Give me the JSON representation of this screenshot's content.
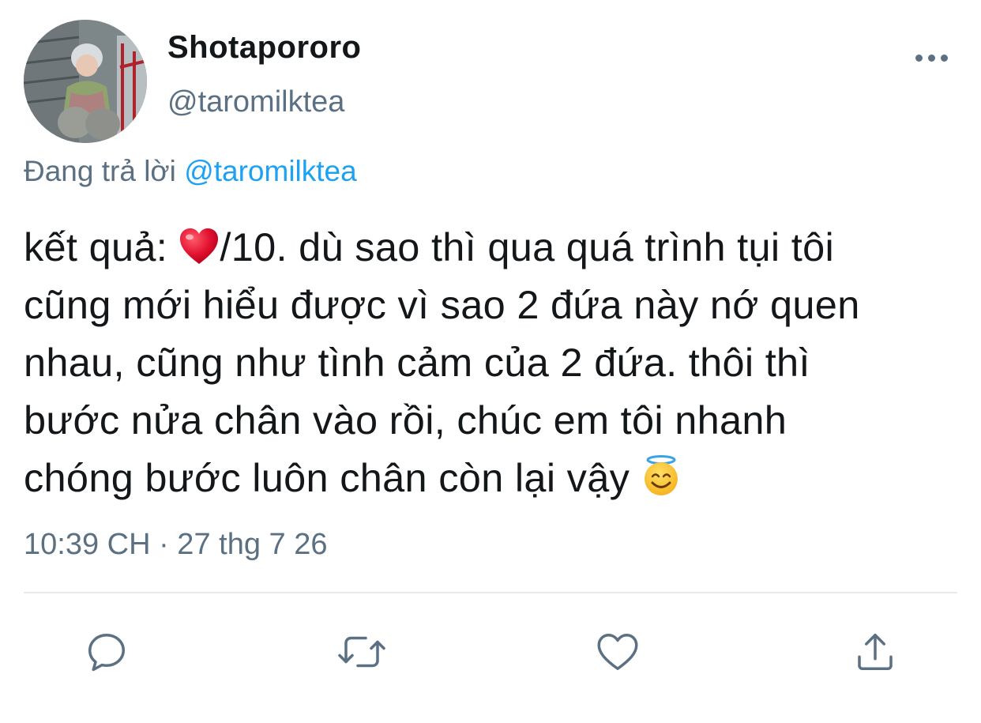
{
  "tweet": {
    "display_name": "Shotapororo",
    "handle": "@taromilktea",
    "replying_prefix": "Đang trả lời",
    "replying_to": "@taromilktea",
    "text_lines": [
      {
        "before": "kết quả: ",
        "emoji": "red-heart-emoji",
        "after": "/10. dù sao thì qua quá trình tụi tôi"
      },
      {
        "text": "cũng mới hiểu được vì sao 2 đứa này nớ quen"
      },
      {
        "text": "nhau, cũng như tình cảm của 2 đứa. thôi thì"
      },
      {
        "text": "bước nửa chân vào rồi, chúc em tôi nhanh"
      },
      {
        "before": "chóng bước luôn chân còn lại vậy ",
        "emoji": "smiling-face-with-halo-emoji"
      }
    ],
    "timestamp": "10:39 CH · 27 thg 7 26"
  },
  "icons": {
    "more": "more-horizontal-icon",
    "reply": "reply-icon",
    "retweet": "retweet-icon",
    "like": "heart-icon",
    "share": "share-icon"
  },
  "colors": {
    "text": "#14171a",
    "secondary": "#5b7083",
    "accent": "#1da1f2",
    "divider": "#e6ecf0",
    "heart": "#e0102e",
    "halo_face": "#ffcc33"
  }
}
